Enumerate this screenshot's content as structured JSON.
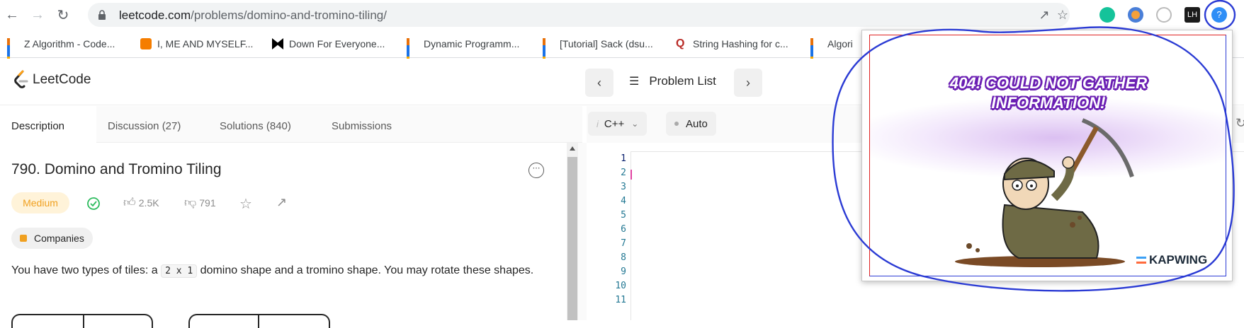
{
  "browser": {
    "url_host": "leetcode.com",
    "url_path": "/problems/domino-and-tromino-tiling/",
    "bookmarks": [
      {
        "label": "Z Algorithm - Code...",
        "icon": "bar-chart-icon"
      },
      {
        "label": "I, ME AND MYSELF...",
        "icon": "blogger-icon"
      },
      {
        "label": "Down For Everyone...",
        "icon": "dfe-icon"
      },
      {
        "label": "Dynamic Programm...",
        "icon": "bar-chart-icon"
      },
      {
        "label": "[Tutorial] Sack (dsu...",
        "icon": "bar-chart-icon"
      },
      {
        "label": "String Hashing for c...",
        "icon": "quora-icon"
      },
      {
        "label": "Algori",
        "icon": "bar-chart-icon"
      }
    ],
    "extensions": [
      "grammarly-icon",
      "chrome-ext-icon",
      "history-ext-icon",
      "lh-ext-icon",
      "leetcode-helper-icon"
    ]
  },
  "header": {
    "logo_text": "LeetCode",
    "problem_list_label": "Problem List"
  },
  "tabs": [
    {
      "label": "Description",
      "active": true
    },
    {
      "label": "Discussion (27)"
    },
    {
      "label": "Solutions (840)"
    },
    {
      "label": "Submissions"
    }
  ],
  "problem": {
    "title": "790. Domino and Tromino Tiling",
    "difficulty": "Medium",
    "likes": "2.5K",
    "dislikes": "791",
    "companies_label": "Companies",
    "desc_before": "You have two types of tiles: a ",
    "desc_code": "2 x 1",
    "desc_after": " domino shape and a tromino shape. You may rotate these shapes."
  },
  "editor": {
    "language": "C++",
    "mode": "Auto",
    "line_numbers": [
      "1",
      "2",
      "3",
      "4",
      "5",
      "6",
      "7",
      "8",
      "9",
      "10",
      "11"
    ]
  },
  "popup": {
    "error_line1": "404! Could not gather",
    "error_line2": "information!",
    "watermark": "KAPWING"
  },
  "colors": {
    "accent_orange": "#ffa116",
    "medium_bg": "#fff3d9",
    "medium_text": "#f0a020",
    "solved_green": "#2cbb5d",
    "annotation_blue": "#2b3bd4"
  }
}
